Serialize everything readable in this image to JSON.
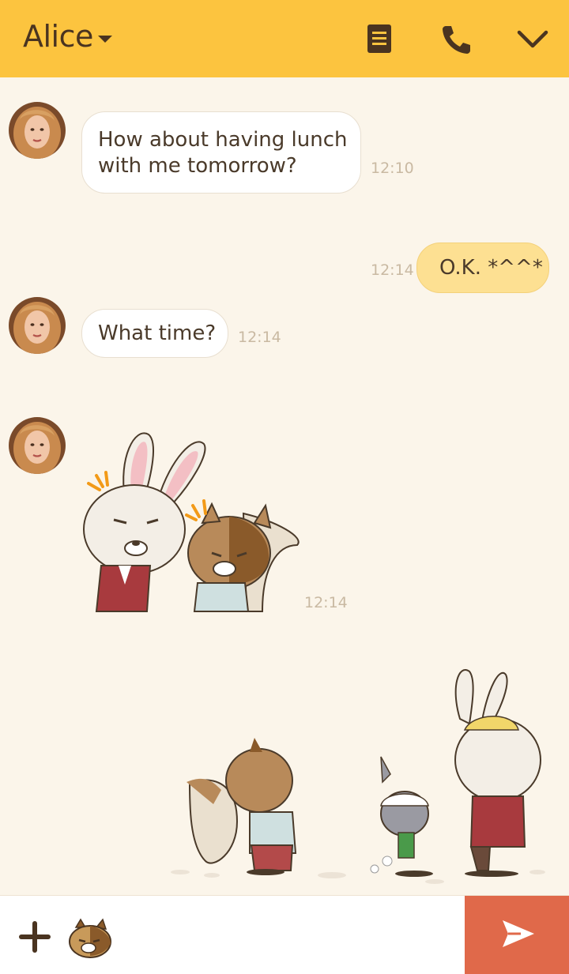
{
  "header": {
    "title": "Alice",
    "icons": [
      "document-icon",
      "phone-icon",
      "chevron-down-icon"
    ]
  },
  "messages": [
    {
      "sender": "Alice",
      "type": "text",
      "text_line1": "How about having lunch",
      "text_line2": "with me tomorrow?",
      "time": "12:10"
    },
    {
      "sender": "me",
      "type": "text",
      "text": "O.K. *^^*",
      "time": "12:14"
    },
    {
      "sender": "Alice",
      "type": "text",
      "text": "What time?",
      "time": "12:14"
    },
    {
      "sender": "Alice",
      "type": "sticker",
      "sticker": "rabbit-and-squirrel-sticker",
      "time": "12:14"
    }
  ],
  "colors": {
    "header_bg": "#fcc43f",
    "chat_bg": "#fbf5ea",
    "my_bubble": "#fde092",
    "send_button": "#e0694a"
  }
}
